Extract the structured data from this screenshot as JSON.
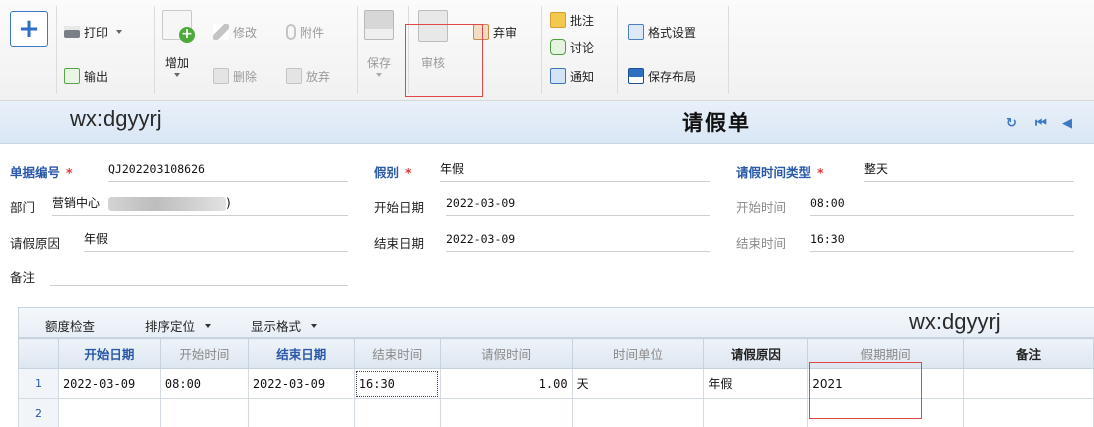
{
  "toolbar": {
    "add_symbol": "+",
    "print_label": "打印",
    "export_label": "输出",
    "add_label": "增加",
    "edit_label": "修改",
    "attach_label": "附件",
    "delete_label": "删除",
    "abandon_label": "放弃",
    "save_label": "保存",
    "audit_label": "审核",
    "reject_label": "弃审",
    "annotate_label": "批注",
    "discuss_label": "讨论",
    "notify_label": "通知",
    "format_settings_label": "格式设置",
    "save_layout_label": "保存布局"
  },
  "watermark": "wx:dgyyrj",
  "header": {
    "title": "请假单"
  },
  "form": {
    "doc_no_label": "单据编号",
    "doc_no": "QJ202203108626",
    "dept_label": "部门",
    "dept_value": "营销中心",
    "dept_suffix": ")",
    "reason_label": "请假原因",
    "reason_value": "年假",
    "remark_label": "备注",
    "remark_value": "",
    "leave_type_label": "假别",
    "leave_type": "年假",
    "start_date_label": "开始日期",
    "start_date": "2022-03-09",
    "end_date_label": "结束日期",
    "end_date": "2022-03-09",
    "time_type_label": "请假时间类型",
    "time_type": "整天",
    "start_time_label": "开始时间",
    "start_time": "08:00",
    "end_time_label": "结束时间",
    "end_time": "16:30"
  },
  "grid": {
    "toolbar": {
      "quota_check": "额度检查",
      "sort_locate": "排序定位",
      "display_format": "显示格式"
    },
    "columns": [
      "开始日期",
      "开始时间",
      "结束日期",
      "结束时间",
      "请假时间",
      "时间单位",
      "请假原因",
      "假期期间",
      "备注"
    ],
    "rows": [
      {
        "rownum": "1",
        "start_date": "2022-03-09",
        "start_time": "08:00",
        "end_date": "2022-03-09",
        "end_time": "16:30",
        "hours": "1.00",
        "unit": "天",
        "reason": "年假",
        "period": "2021",
        "remark": ""
      },
      {
        "rownum": "2",
        "start_date": "",
        "start_time": "",
        "end_date": "",
        "end_time": "",
        "hours": "",
        "unit": "",
        "reason": "",
        "period": "",
        "remark": ""
      }
    ]
  },
  "colors": {
    "accent": "#2a59a8",
    "highlight": "#e04848",
    "required": "#e23a3a"
  },
  "icons": [
    "add-icon",
    "printer-icon",
    "export-icon",
    "add-doc-icon",
    "pencil-icon",
    "paperclip-icon",
    "delete-icon",
    "abandon-icon",
    "floppy-disk-icon",
    "clipboard-icon",
    "reject-icon",
    "annotate-icon",
    "discuss-icon",
    "megaphone-icon",
    "format-settings-icon",
    "save-layout-icon",
    "refresh-icon",
    "first-page-icon",
    "prev-page-icon"
  ]
}
